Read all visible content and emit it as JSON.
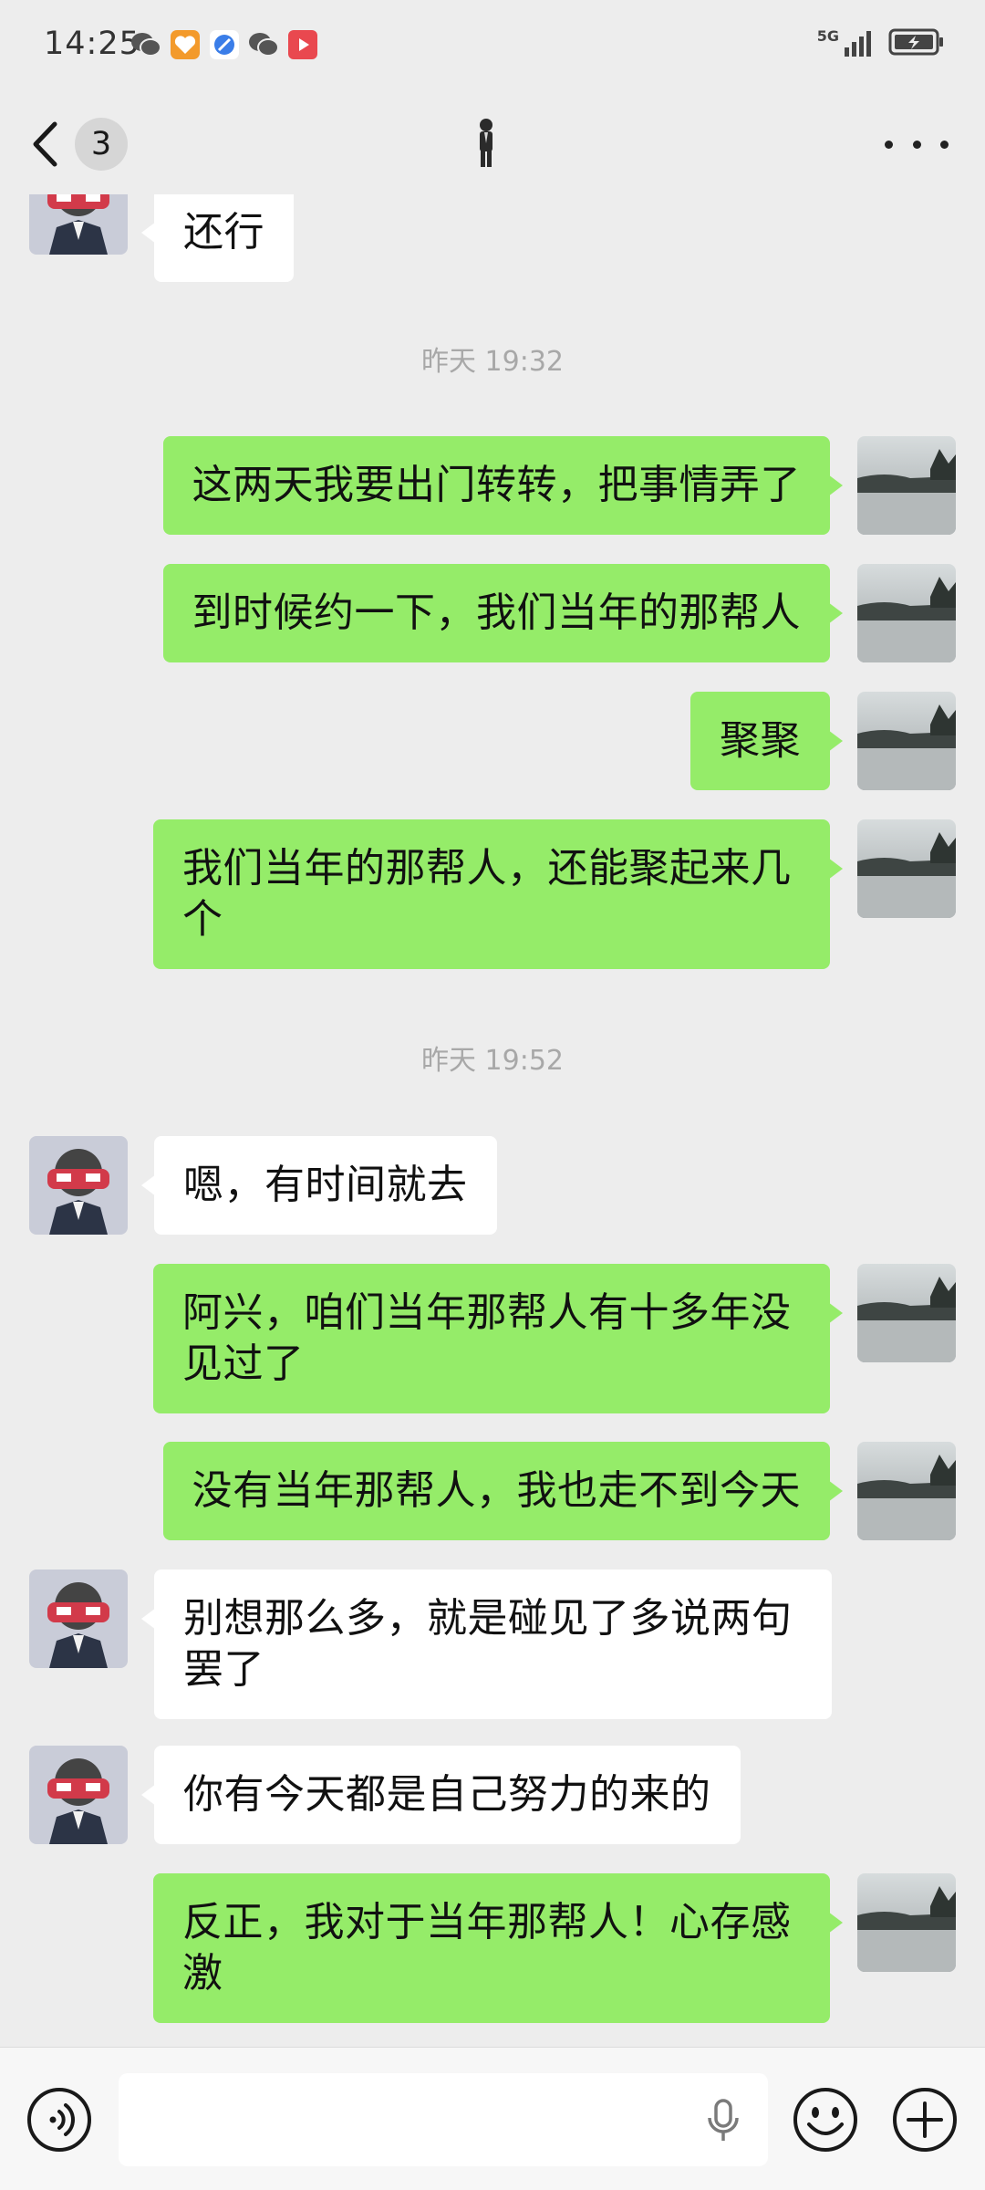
{
  "status_bar": {
    "time": "14:25",
    "network": "5G",
    "app_icons": [
      "wechat-icon",
      "heart-app-icon",
      "browser-icon",
      "wechat-icon",
      "video-app-icon"
    ]
  },
  "title_bar": {
    "unread_count": "3",
    "title_icon": "person-figure-icon"
  },
  "messages": [
    {
      "type": "text",
      "side": "in",
      "text": "还行"
    },
    {
      "type": "time",
      "text": "昨天 19:32"
    },
    {
      "type": "text",
      "side": "out",
      "text": "这两天我要出门转转，把事情弄了"
    },
    {
      "type": "text",
      "side": "out",
      "text": "到时候约一下，我们当年的那帮人"
    },
    {
      "type": "text",
      "side": "out",
      "text": "聚聚"
    },
    {
      "type": "text",
      "side": "out",
      "text": "我们当年的那帮人，还能聚起来几个"
    },
    {
      "type": "time",
      "text": "昨天 19:52"
    },
    {
      "type": "text",
      "side": "in",
      "text": "嗯，有时间就去"
    },
    {
      "type": "text",
      "side": "out",
      "text": "阿兴，咱们当年那帮人有十多年没见过了"
    },
    {
      "type": "text",
      "side": "out",
      "text": "没有当年那帮人，我也走不到今天"
    },
    {
      "type": "text",
      "side": "in",
      "text": "别想那么多，就是碰见了多说两句罢了"
    },
    {
      "type": "text",
      "side": "in",
      "text": "你有今天都是自己努力的来的"
    },
    {
      "type": "text",
      "side": "out",
      "text": "反正，我对于当年那帮人！心存感激"
    }
  ],
  "input_bar": {
    "value": "",
    "placeholder": ""
  },
  "colors": {
    "background": "#ededed",
    "outgoing_bubble": "#95ec69",
    "incoming_bubble": "#ffffff",
    "timestamp_text": "#a8a8a8"
  }
}
